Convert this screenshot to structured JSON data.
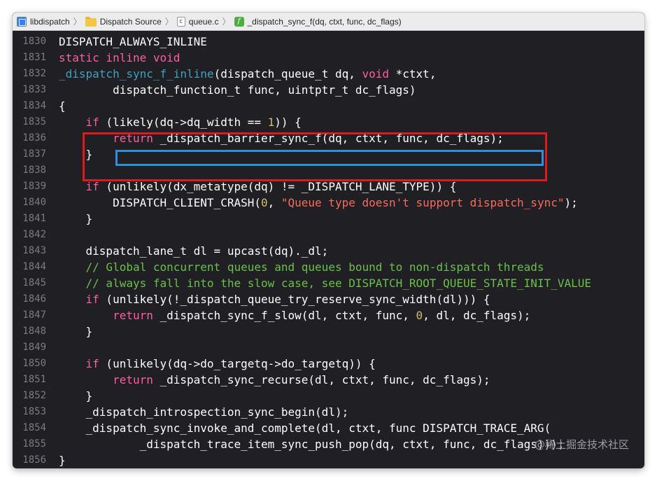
{
  "breadcrumb": [
    {
      "label": "libdispatch",
      "icon": "project-icon"
    },
    {
      "label": "Dispatch Source",
      "icon": "folder-icon"
    },
    {
      "label": "queue.c",
      "icon": "c-file-icon"
    },
    {
      "label": "_dispatch_sync_f(dq, ctxt, func, dc_flags)",
      "icon": "function-icon"
    }
  ],
  "icons": {
    "file_glyph": "c",
    "func_glyph": "f"
  },
  "colors": {
    "background": "#1f1f24",
    "keyword": "#fc5fa3",
    "function": "#41a1c0",
    "number": "#d0bf69",
    "string": "#fc6a5d",
    "comment": "#6bc04a",
    "highlight_red": "#e01a1a",
    "highlight_blue": "#2f8fd8"
  },
  "lines": [
    {
      "num": "1830",
      "tokens": [
        {
          "t": "DISPATCH_ALWAYS_INLINE"
        }
      ]
    },
    {
      "num": "1831",
      "tokens": [
        {
          "t": "static inline void",
          "c": "kw"
        }
      ]
    },
    {
      "num": "1832",
      "tokens": [
        {
          "t": "_dispatch_sync_f_inline",
          "c": "fn"
        },
        {
          "t": "(dispatch_queue_t dq, "
        },
        {
          "t": "void",
          "c": "kw"
        },
        {
          "t": " *ctxt,"
        }
      ]
    },
    {
      "num": "1833",
      "tokens": [
        {
          "t": "        dispatch_function_t func, uintptr_t dc_flags)"
        }
      ]
    },
    {
      "num": "1834",
      "tokens": [
        {
          "t": "{"
        }
      ]
    },
    {
      "num": "1835",
      "tokens": [
        {
          "t": "    "
        },
        {
          "t": "if",
          "c": "kw"
        },
        {
          "t": " (likely(dq->dq_width == "
        },
        {
          "t": "1",
          "c": "num"
        },
        {
          "t": ")) {"
        }
      ]
    },
    {
      "num": "1836",
      "tokens": [
        {
          "t": "        "
        },
        {
          "t": "return",
          "c": "kw"
        },
        {
          "t": " _dispatch_barrier_sync_f(dq, ctxt, func, dc_flags);"
        }
      ]
    },
    {
      "num": "1837",
      "tokens": [
        {
          "t": "    }"
        }
      ]
    },
    {
      "num": "1838",
      "tokens": []
    },
    {
      "num": "1839",
      "tokens": [
        {
          "t": "    "
        },
        {
          "t": "if",
          "c": "kw"
        },
        {
          "t": " (unlikely(dx_metatype(dq) != _DISPATCH_LANE_TYPE)) {"
        }
      ]
    },
    {
      "num": "1840",
      "tokens": [
        {
          "t": "        DISPATCH_CLIENT_CRASH("
        },
        {
          "t": "0",
          "c": "num"
        },
        {
          "t": ", "
        },
        {
          "t": "\"Queue type doesn't support dispatch_sync\"",
          "c": "str"
        },
        {
          "t": ");"
        }
      ]
    },
    {
      "num": "1841",
      "tokens": [
        {
          "t": "    }"
        }
      ]
    },
    {
      "num": "1842",
      "tokens": []
    },
    {
      "num": "1843",
      "tokens": [
        {
          "t": "    dispatch_lane_t dl = upcast(dq)._dl;"
        }
      ]
    },
    {
      "num": "1844",
      "tokens": [
        {
          "t": "    "
        },
        {
          "t": "// Global concurrent queues and queues bound to non-dispatch threads",
          "c": "cmt"
        }
      ]
    },
    {
      "num": "1845",
      "tokens": [
        {
          "t": "    "
        },
        {
          "t": "// always fall into the slow case, see DISPATCH_ROOT_QUEUE_STATE_INIT_VALUE",
          "c": "cmt"
        }
      ]
    },
    {
      "num": "1846",
      "tokens": [
        {
          "t": "    "
        },
        {
          "t": "if",
          "c": "kw"
        },
        {
          "t": " (unlikely(!_dispatch_queue_try_reserve_sync_width(dl))) {"
        }
      ]
    },
    {
      "num": "1847",
      "tokens": [
        {
          "t": "        "
        },
        {
          "t": "return",
          "c": "kw"
        },
        {
          "t": " _dispatch_sync_f_slow(dl, ctxt, func, "
        },
        {
          "t": "0",
          "c": "num"
        },
        {
          "t": ", dl, dc_flags);"
        }
      ]
    },
    {
      "num": "1848",
      "tokens": [
        {
          "t": "    }"
        }
      ]
    },
    {
      "num": "1849",
      "tokens": []
    },
    {
      "num": "1850",
      "tokens": [
        {
          "t": "    "
        },
        {
          "t": "if",
          "c": "kw"
        },
        {
          "t": " (unlikely(dq->do_targetq->do_targetq)) {"
        }
      ]
    },
    {
      "num": "1851",
      "tokens": [
        {
          "t": "        "
        },
        {
          "t": "return",
          "c": "kw"
        },
        {
          "t": " _dispatch_sync_recurse(dl, ctxt, func, dc_flags);"
        }
      ]
    },
    {
      "num": "1852",
      "tokens": [
        {
          "t": "    }"
        }
      ]
    },
    {
      "num": "1853",
      "tokens": [
        {
          "t": "    _dispatch_introspection_sync_begin(dl);"
        }
      ]
    },
    {
      "num": "1854",
      "tokens": [
        {
          "t": "    _dispatch_sync_invoke_and_complete(dl, ctxt, func DISPATCH_TRACE_ARG("
        }
      ]
    },
    {
      "num": "1855",
      "tokens": [
        {
          "t": "            _dispatch_trace_item_sync_push_pop(dq, ctxt, func, dc_flags)));"
        }
      ]
    },
    {
      "num": "1856",
      "tokens": [
        {
          "t": "}"
        }
      ]
    }
  ],
  "watermark": "@稀土掘金技术社区"
}
